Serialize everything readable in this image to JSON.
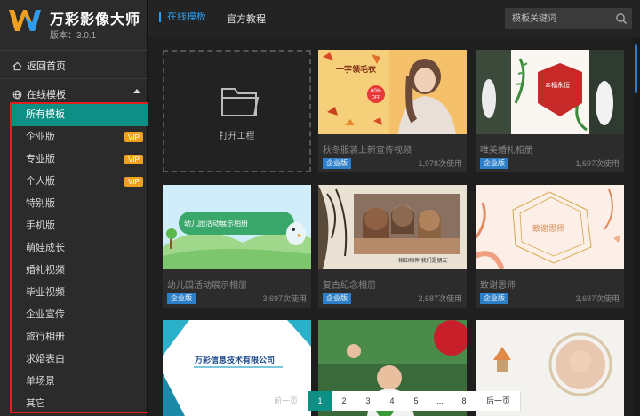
{
  "app": {
    "name": "万彩影像大师",
    "version": "版本：3.0.1"
  },
  "sidebar": {
    "home_label": "返回首页",
    "online_label": "在线模板",
    "categories": [
      {
        "label": "所有模板",
        "vip": false,
        "active": true
      },
      {
        "label": "企业版",
        "vip": true
      },
      {
        "label": "专业版",
        "vip": true
      },
      {
        "label": "个人版",
        "vip": true
      },
      {
        "label": "特别版",
        "vip": false
      },
      {
        "label": "手机版",
        "vip": false
      },
      {
        "label": "萌娃成长",
        "vip": false
      },
      {
        "label": "婚礼视频",
        "vip": false
      },
      {
        "label": "毕业视频",
        "vip": false
      },
      {
        "label": "企业宣传",
        "vip": false
      },
      {
        "label": "旅行相册",
        "vip": false
      },
      {
        "label": "求婚表白",
        "vip": false
      },
      {
        "label": "单场景",
        "vip": false
      },
      {
        "label": "其它",
        "vip": false
      }
    ],
    "vip_label": "VIP"
  },
  "header": {
    "tabs": [
      "在线模板",
      "官方教程"
    ],
    "search_placeholder": "模板关键词"
  },
  "open_project": {
    "label": "打开工程"
  },
  "cards": [
    {
      "title": "秋冬服装上新宣传视频",
      "tag": "企业版",
      "uses": "1,978次使用",
      "thumb_text": [
        "一字领毛衣",
        "60%",
        "OFF"
      ]
    },
    {
      "title": "唯美婚礼相册",
      "tag": "企业版",
      "uses": "1,697次使用",
      "thumb_text": [
        "幸福永恒"
      ]
    },
    {
      "title": "幼儿园活动展示相册",
      "tag": "企业版",
      "uses": "3,697次使用",
      "thumb_text": [
        "幼儿园活动展示相册"
      ]
    },
    {
      "title": "复古纪念相册",
      "tag": "企业版",
      "uses": "2,687次使用",
      "thumb_text": [
        "相知相伴 我们是朋友"
      ]
    },
    {
      "title": "致谢恩师",
      "tag": "企业版",
      "uses": "3,697次使用",
      "thumb_text": [
        "致谢恩师"
      ]
    },
    {
      "title": "",
      "tag": "",
      "uses": "",
      "thumb_text": [
        "万彩信息技术有限公司"
      ]
    },
    {
      "title": "",
      "tag": "",
      "uses": "",
      "thumb_text": []
    },
    {
      "title": "",
      "tag": "",
      "uses": "",
      "thumb_text": []
    }
  ],
  "pagination": {
    "prev": "前一页",
    "pages": [
      "1",
      "2",
      "3",
      "4",
      "5",
      "...",
      "8"
    ],
    "next": "后一页",
    "current": "1"
  },
  "colors": {
    "accent": "#0e8f85",
    "link": "#2d9cf0",
    "vip": "#f0a020",
    "tag": "#2d7fc8",
    "highlight_border": "#e02020"
  }
}
